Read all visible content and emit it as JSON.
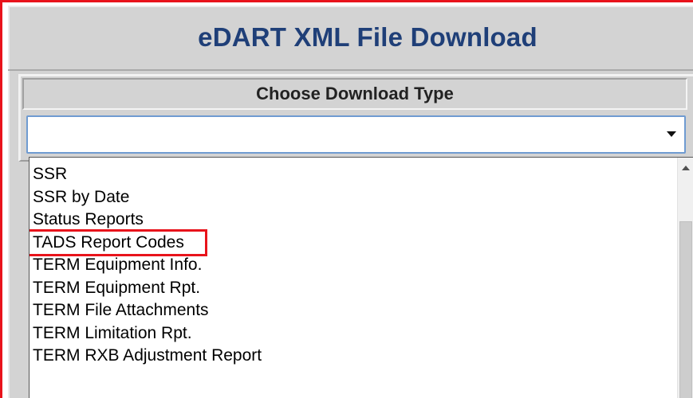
{
  "window": {
    "title": "eDART XML File Download"
  },
  "download_type": {
    "header": "Choose Download Type",
    "selected_value": "",
    "options": [
      {
        "label": "SSR"
      },
      {
        "label": "SSR by Date"
      },
      {
        "label": "Status Reports"
      },
      {
        "label": "TADS Report Codes"
      },
      {
        "label": "TERM Equipment Info."
      },
      {
        "label": "TERM Equipment Rpt."
      },
      {
        "label": "TERM File Attachments"
      },
      {
        "label": "TERM Limitation Rpt."
      },
      {
        "label": "TERM RXB Adjustment Report"
      }
    ],
    "highlighted_option": "TADS Report Codes"
  },
  "colors": {
    "highlight_border": "#e8131b",
    "title_text": "#1f3f78",
    "panel_background": "#d3d3d3",
    "select_border": "#6f9bd1"
  },
  "icons": {
    "dropdown": "chevron-down-icon",
    "scroll_up": "scroll-up-arrow-icon"
  }
}
